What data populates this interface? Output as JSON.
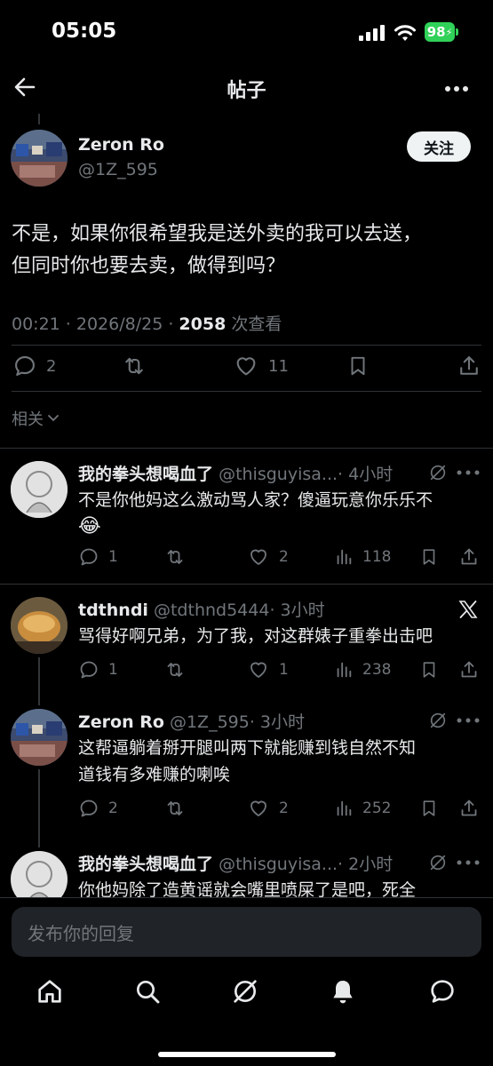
{
  "status_bar": {
    "time": "05:05",
    "battery": "98"
  },
  "header": {
    "title": "帖子"
  },
  "main_post": {
    "name": "Zeron Ro",
    "handle": "@1Z_595",
    "follow_label": "关注",
    "text_line1": "不是，如果你很希望我是送外卖的我可以去送，",
    "text_line2": "但同时你也要去卖，做得到吗？",
    "meta_time": "00:21 · 2026/8/25 · ",
    "meta_views": "2058",
    "meta_views_label": " 次查看",
    "replies": "2",
    "likes": "11"
  },
  "related_label": "相关",
  "replies": [
    {
      "name": "我的拳头想喝血了",
      "handle": "@thisguyisa...",
      "time": "· 4小时",
      "text_line1": "不是你他妈这么激动骂人家？傻逼玩意你乐乐不",
      "emoji": "😂",
      "replies": "1",
      "likes": "2",
      "views": "118"
    },
    {
      "name": "tdthndi",
      "handle": "@tdthnd5444",
      "time": "· 3小时",
      "text_line1": "骂得好啊兄弟，为了我，对这群婊子重拳出击吧",
      "replies": "1",
      "likes": "1",
      "views": "238"
    },
    {
      "name": "Zeron Ro",
      "handle": "@1Z_595",
      "time": "· 3小时",
      "text_line1": "这帮逼躺着掰开腿叫两下就能赚到钱自然不知",
      "text_line2": "道钱有多难赚的喇唉",
      "replies": "2",
      "likes": "2",
      "views": "252"
    },
    {
      "name": "我的拳头想喝血了",
      "handle": "@thisguyisa...",
      "time": "· 2小时",
      "text_line1": "你他妈除了造黄谣就会嘴里喷屎了是吧，死全"
    }
  ],
  "reply_input": {
    "placeholder": "发布你的回复"
  },
  "tabbar": [
    "home-icon",
    "search-icon",
    "grok-icon",
    "notifications-icon",
    "messages-icon"
  ]
}
